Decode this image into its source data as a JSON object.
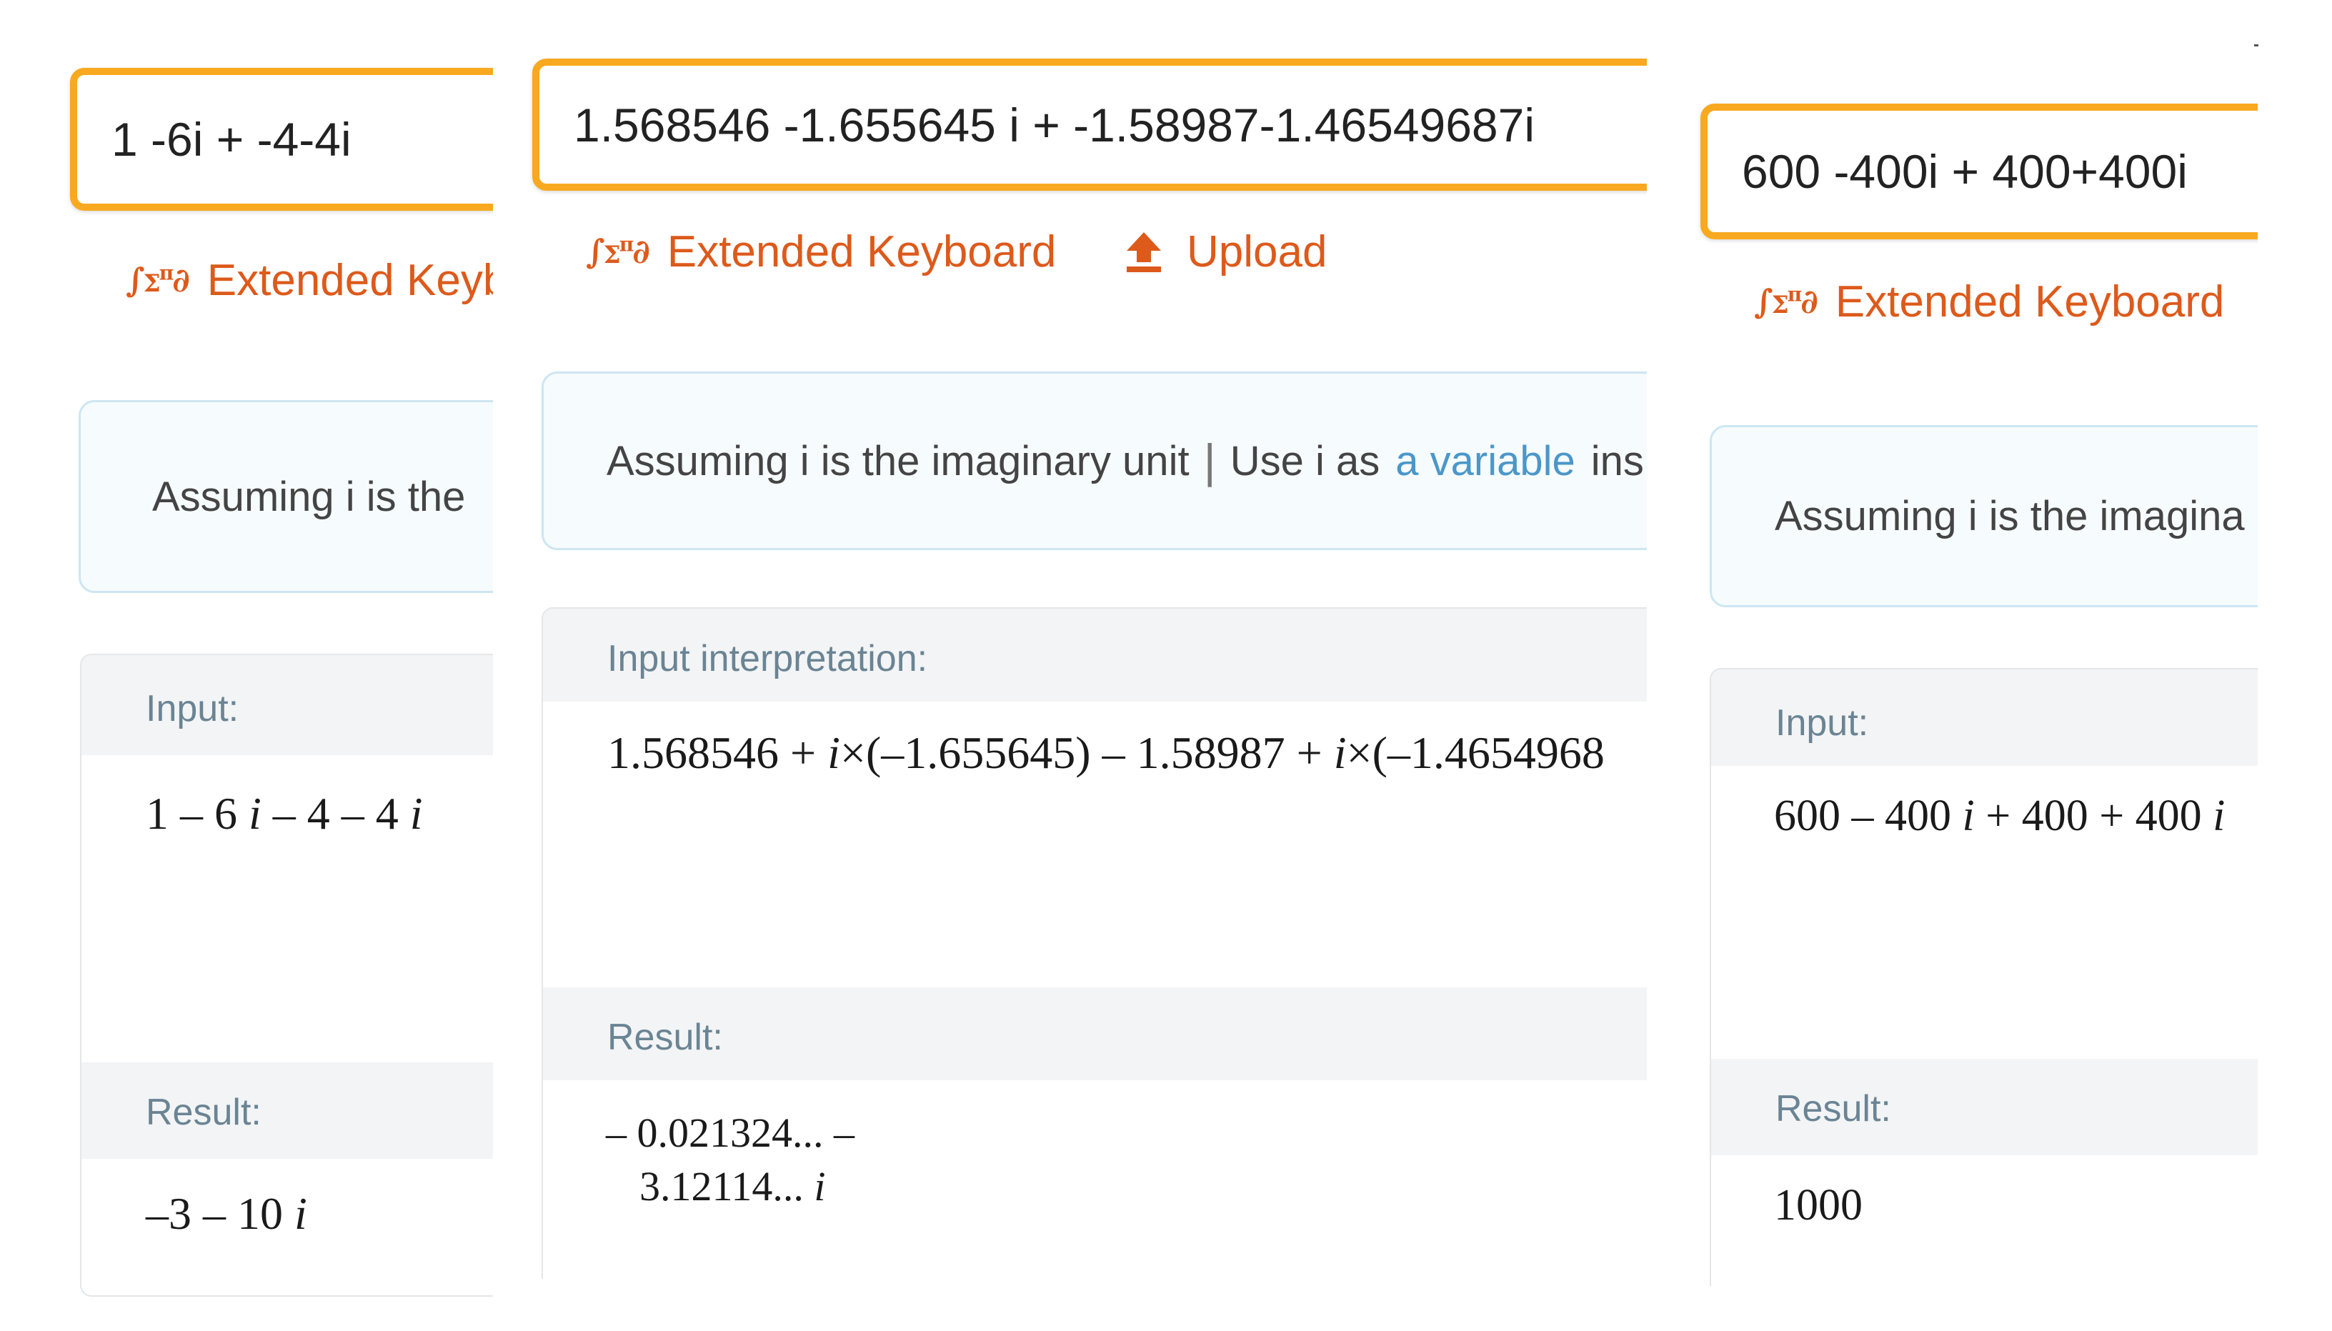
{
  "panels": [
    {
      "query_value": "1 -6i + -4-4i",
      "extended_keyboard_label": "Extended Keyb",
      "assumption": {
        "text": "Assuming i is the"
      },
      "pods": [
        {
          "title": "Input:",
          "expr_segments": [
            "1 – 6 ",
            "i",
            " – 4 – 4 ",
            "i"
          ]
        },
        {
          "title": "Result:",
          "expr_segments": [
            "–3 – 10 ",
            "i"
          ]
        }
      ]
    },
    {
      "query_value": "1.568546 -1.655645 i + -1.58987-1.46549687i",
      "extended_keyboard_label": "Extended Keyboard",
      "upload_label": "Upload",
      "assumption": {
        "prefix": "Assuming i is the imaginary unit",
        "separator": "|",
        "use_as": "Use i as",
        "link": "a variable",
        "suffix": "ins"
      },
      "pods": [
        {
          "title": "Input interpretation:",
          "expr_segments": [
            "1.568546 + ",
            "i",
            "×(–1.655645) – 1.58987 + ",
            "i",
            "×(–1.4654968"
          ]
        },
        {
          "title": "Result:",
          "line1": "– 0.021324... –",
          "line2_segments": [
            "3.12114... ",
            "i"
          ]
        }
      ]
    },
    {
      "query_value": "600 -400i + 400+400i",
      "extended_keyboard_label": "Extended Keyboard",
      "assumption": {
        "text": "Assuming i is the imagina"
      },
      "pods": [
        {
          "title": "Input:",
          "expr_segments": [
            "600 – 400 ",
            "i",
            " + 400 + 400 ",
            "i"
          ]
        },
        {
          "title": "Result:",
          "expr_segments": [
            "1000"
          ]
        }
      ]
    }
  ],
  "icons": {
    "keyboard": "∫Σπ∂",
    "upload": "upload-arrow"
  },
  "colors": {
    "input_border": "#f8a920",
    "tool_link": "#dd5a1b",
    "assumption_link": "#4b97c9",
    "pod_title": "#6a8494"
  }
}
